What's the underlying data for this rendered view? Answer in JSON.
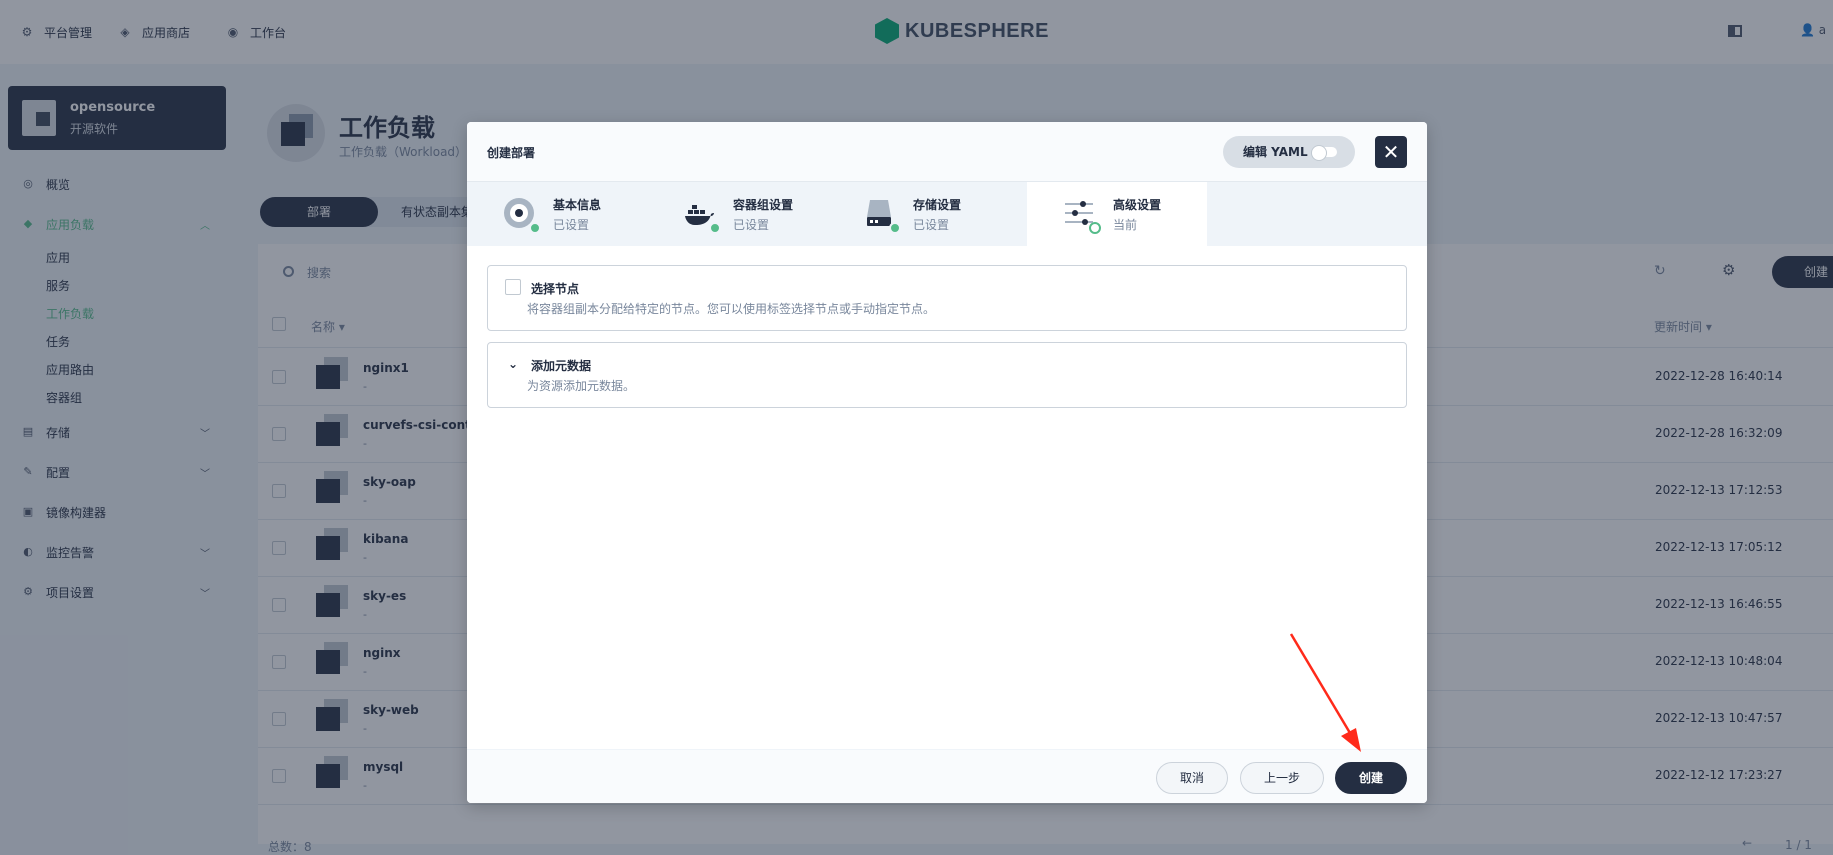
{
  "topnav": {
    "items": [
      {
        "label": "平台管理",
        "icon": "gear-icon"
      },
      {
        "label": "应用商店",
        "icon": "layers-icon"
      },
      {
        "label": "工作台",
        "icon": "dashboard-icon"
      }
    ],
    "logo_text": "KUBESPHERE",
    "user_initial": "a"
  },
  "sidebar": {
    "project_name": "opensource",
    "project_desc": "开源软件",
    "items": [
      {
        "label": "概览",
        "icon": "overview-icon"
      },
      {
        "label": "应用负载",
        "icon": "appload-icon",
        "active": true
      },
      {
        "label": "存储",
        "icon": "storage-icon"
      },
      {
        "label": "配置",
        "icon": "config-icon"
      },
      {
        "label": "镜像构建器",
        "icon": "builder-icon"
      },
      {
        "label": "监控告警",
        "icon": "monitor-icon"
      },
      {
        "label": "项目设置",
        "icon": "settings-icon"
      }
    ],
    "sub_items": [
      "应用",
      "服务",
      "工作负载",
      "任务",
      "应用路由",
      "容器组"
    ],
    "active_sub": "工作负载"
  },
  "page": {
    "title": "工作负载",
    "subtitle": "工作负载（Workload）是",
    "tabs": [
      "部署",
      "有状态副本集"
    ],
    "search_placeholder": "搜索",
    "create_label": "创建",
    "col_name": "名称",
    "col_time": "更新时间",
    "rows": [
      {
        "name": "nginx1",
        "sub": "-",
        "time": "2022-12-28 16:40:14"
      },
      {
        "name": "curvefs-csi-control",
        "sub": "-",
        "time": "2022-12-28 16:32:09"
      },
      {
        "name": "sky-oap",
        "sub": "-",
        "time": "2022-12-13 17:12:53"
      },
      {
        "name": "kibana",
        "sub": "-",
        "time": "2022-12-13 17:05:12"
      },
      {
        "name": "sky-es",
        "sub": "-",
        "time": "2022-12-13 16:46:55"
      },
      {
        "name": "nginx",
        "sub": "-",
        "time": "2022-12-13 10:48:04"
      },
      {
        "name": "sky-web",
        "sub": "-",
        "time": "2022-12-13 10:47:57"
      },
      {
        "name": "mysql",
        "sub": "-",
        "time": "2022-12-12 17:23:27"
      }
    ],
    "total": "总数：8",
    "pagination": "1 / 1"
  },
  "modal": {
    "title": "创建部署",
    "yaml_label": "编辑 YAML",
    "steps": [
      {
        "title": "基本信息",
        "status": "已设置"
      },
      {
        "title": "容器组设置",
        "status": "已设置"
      },
      {
        "title": "存储设置",
        "status": "已设置"
      },
      {
        "title": "高级设置",
        "status": "当前"
      }
    ],
    "node_selector": {
      "title": "选择节点",
      "desc": "将容器组副本分配给特定的节点。您可以使用标签选择节点或手动指定节点。"
    },
    "metadata": {
      "title": "添加元数据",
      "desc": "为资源添加元数据。"
    },
    "buttons": {
      "cancel": "取消",
      "prev": "上一步",
      "create": "创建"
    }
  },
  "colors": {
    "accent": "#55bc8a",
    "dark": "#242e42",
    "annotation": "#ff2a1a"
  }
}
